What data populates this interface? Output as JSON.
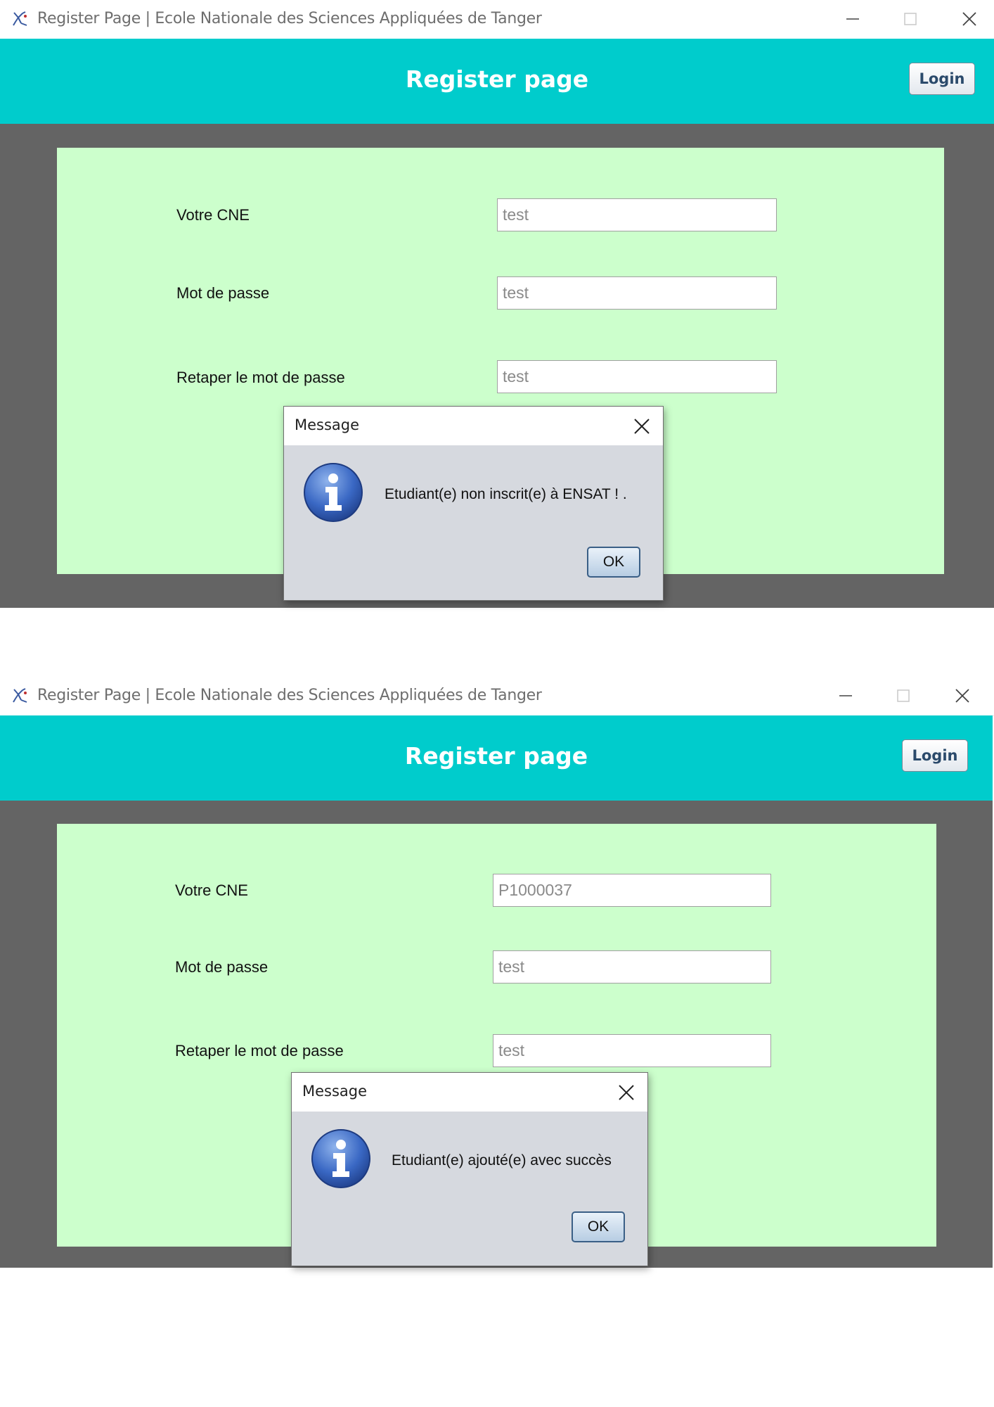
{
  "screenshots": [
    {
      "window": {
        "title": "Register Page | Ecole Nationale des Sciences Appliquées de Tanger",
        "controls": [
          "minimize-icon",
          "maximize-icon",
          "close-icon"
        ]
      },
      "header": {
        "title": "Register page",
        "login_label": "Login"
      },
      "form": {
        "cne_label": "Votre CNE",
        "cne_value": "test",
        "password_label": "Mot de passe",
        "password_value": "test",
        "retype_label": "Retaper le mot de passe",
        "retype_value": "test"
      },
      "dialog": {
        "title": "Message",
        "icon": "info-icon",
        "message": "Etudiant(e) non inscrit(e) à ENSAT ! .",
        "ok_label": "OK"
      }
    },
    {
      "window": {
        "title": "Register Page | Ecole Nationale des Sciences Appliquées de Tanger",
        "controls": [
          "minimize-icon",
          "maximize-icon",
          "close-icon"
        ]
      },
      "header": {
        "title": "Register page",
        "login_label": "Login"
      },
      "form": {
        "cne_label": "Votre CNE",
        "cne_value": "P1000037",
        "password_label": "Mot de passe",
        "password_value": "test",
        "retype_label": "Retaper le mot de passe",
        "retype_value": "test"
      },
      "dialog": {
        "title": "Message",
        "icon": "info-icon",
        "message": "Etudiant(e) ajouté(e) avec succès",
        "ok_label": "OK"
      }
    }
  ],
  "colors": {
    "header": "#00cccc",
    "background": "#646464",
    "form_panel": "#ccffcc",
    "dialog": "#d6d9df"
  }
}
